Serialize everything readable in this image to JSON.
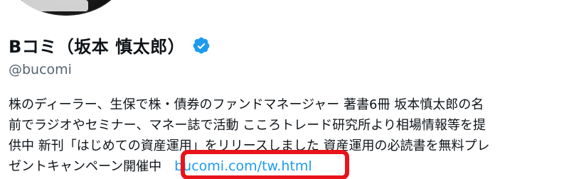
{
  "profile": {
    "display_name": "Bコミ（坂本 慎太郎）",
    "verified_badge": "verified-badge-icon",
    "handle": "@bucomi",
    "bio_lines": [
      "株のディーラー、生保で株・債券のファンドマネージャー 著書6冊  坂本慎太郎の名",
      "前でラジオやセミナー、マネー誌で活動 こころトレード研究所より相場情報等を提",
      "供中 新刊「はじめての資産運用」をリリースしました 資産運用の必読書を無料プレ",
      "ゼントキャンペーン開催中"
    ],
    "bio_link": "bucomi.com/tw.html"
  },
  "colors": {
    "text": "#0f1419",
    "secondary_text": "#536471",
    "link": "#1d9bf0",
    "verified": "#1d9bf0",
    "annotation": "#e8141b"
  }
}
